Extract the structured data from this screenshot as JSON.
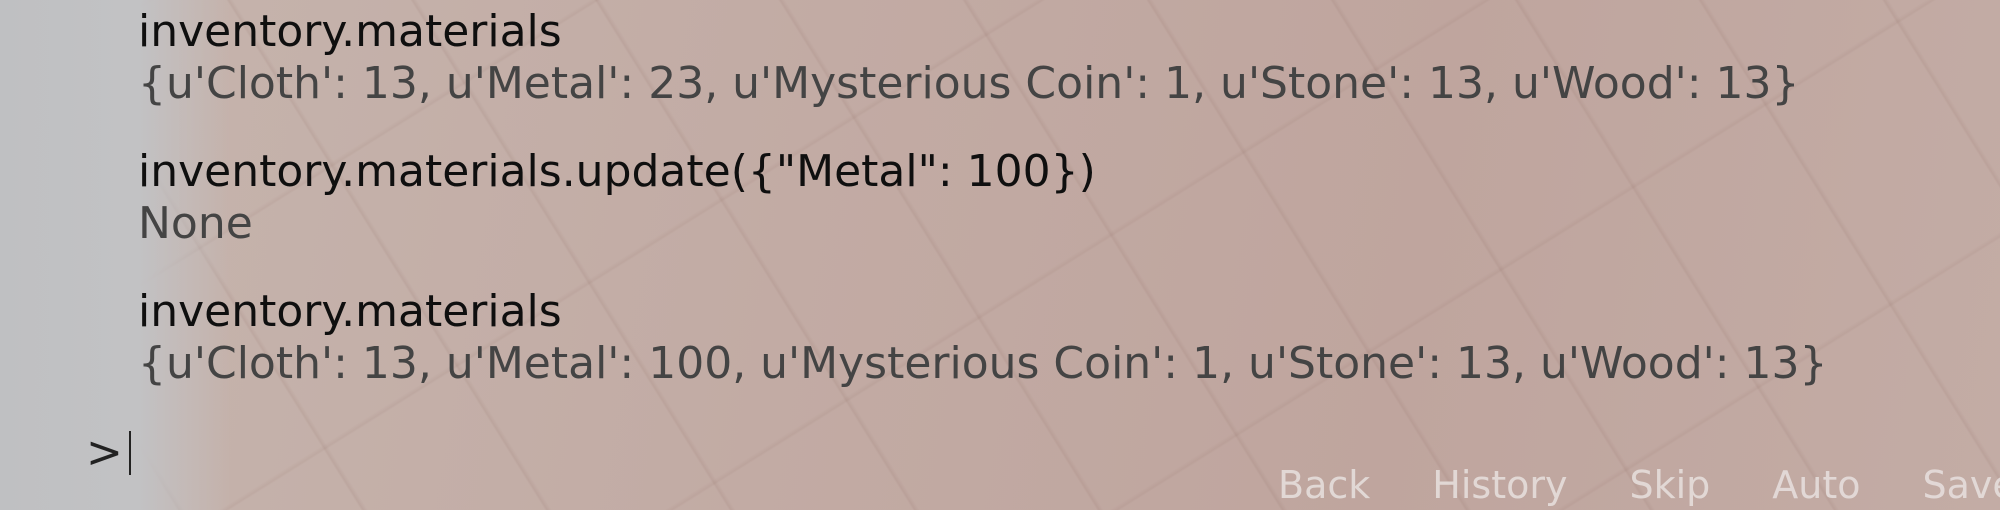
{
  "console": {
    "history": [
      {
        "command": "inventory.materials",
        "result": "{u'Cloth': 13, u'Metal': 23, u'Mysterious Coin': 1, u'Stone': 13, u'Wood': 13}"
      },
      {
        "command": "inventory.materials.update({\"Metal\": 100})",
        "result": "None"
      },
      {
        "command": "inventory.materials",
        "result": "{u'Cloth': 13, u'Metal': 100, u'Mysterious Coin': 1, u'Stone': 13, u'Wood': 13}"
      }
    ],
    "prompt_symbol": ">",
    "input_value": ""
  },
  "quick_menu": {
    "items": [
      "Back",
      "History",
      "Skip",
      "Auto",
      "Save"
    ]
  },
  "colors": {
    "command_text": "#0f0f0f",
    "result_text": "#444444",
    "quick_menu_text": "#e8e1df"
  }
}
